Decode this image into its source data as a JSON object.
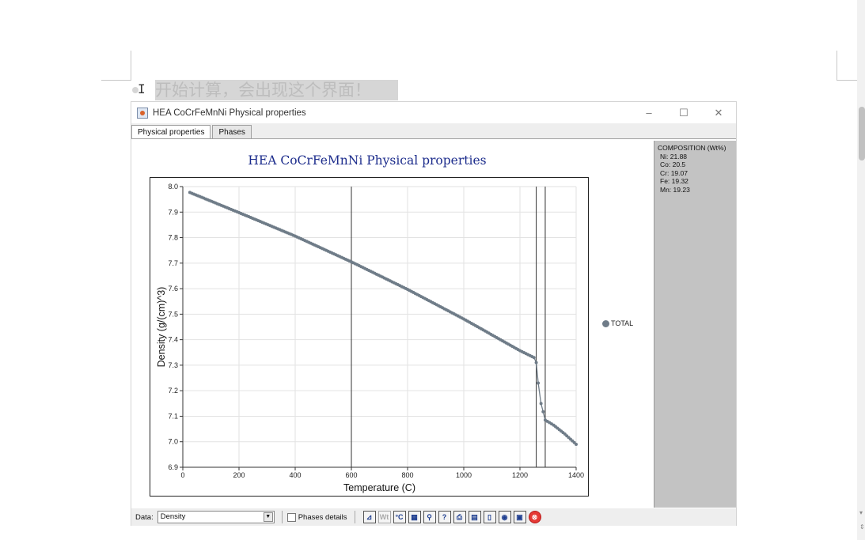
{
  "document": {
    "instruction_text": "开始计算，会出现这个界面！"
  },
  "window": {
    "title": "HEA CoCrFeMnNi Physical properties",
    "controls": {
      "minimize": "–",
      "maximize": "☐",
      "close": "✕"
    }
  },
  "tabs": [
    {
      "label": "Physical properties",
      "active": true
    },
    {
      "label": "Phases",
      "active": false
    }
  ],
  "composition": {
    "header": "COMPOSITION (Wt%)",
    "items": [
      "Ni: 21.88",
      "Co: 20.5",
      "Cr: 19.07",
      "Fe: 19.32",
      "Mn: 19.23"
    ]
  },
  "bottom_bar": {
    "data_label": "Data:",
    "data_value": "Density",
    "phases_details_label": "Phases details",
    "tools": [
      {
        "icon": "plot-icon",
        "glyph": "⊿"
      },
      {
        "icon": "wt-icon",
        "glyph": "Wt",
        "disabled": true
      },
      {
        "icon": "celsius-icon",
        "glyph": "°C"
      },
      {
        "icon": "table-icon",
        "glyph": "▦"
      },
      {
        "icon": "zoom-icon",
        "glyph": "⚲"
      },
      {
        "icon": "help-icon",
        "glyph": "?"
      },
      {
        "icon": "print-icon",
        "glyph": "⎙"
      },
      {
        "icon": "clipboard-icon",
        "glyph": "▤"
      },
      {
        "icon": "page-icon",
        "glyph": "▯"
      },
      {
        "icon": "camera-icon",
        "glyph": "◉"
      },
      {
        "icon": "save-icon",
        "glyph": "▣"
      },
      {
        "icon": "close-icon",
        "glyph": "⊗",
        "red": true
      }
    ]
  },
  "chart_data": {
    "type": "line",
    "title": "HEA CoCrFeMnNi Physical properties",
    "xlabel": "Temperature (C)",
    "ylabel": "Density (g/(cm)^3)",
    "xlim": [
      0,
      1400
    ],
    "ylim": [
      6.9,
      8.0
    ],
    "xticks": [
      0,
      200,
      400,
      600,
      800,
      1000,
      1200,
      1400
    ],
    "yticks": [
      6.9,
      7.0,
      7.1,
      7.2,
      7.3,
      7.4,
      7.5,
      7.6,
      7.7,
      7.8,
      7.9,
      8.0
    ],
    "grid": true,
    "legend_position": "right",
    "vertical_lines_x": [
      600,
      1258,
      1290
    ],
    "series": [
      {
        "name": "TOTAL",
        "color": "#6f7c88",
        "points": [
          [
            25,
            7.977
          ],
          [
            200,
            7.898
          ],
          [
            400,
            7.806
          ],
          [
            600,
            7.705
          ],
          [
            800,
            7.597
          ],
          [
            1000,
            7.481
          ],
          [
            1200,
            7.357
          ],
          [
            1250,
            7.33
          ],
          [
            1258,
            7.31
          ],
          [
            1265,
            7.23
          ],
          [
            1275,
            7.15
          ],
          [
            1290,
            7.085
          ],
          [
            1320,
            7.065
          ],
          [
            1360,
            7.03
          ],
          [
            1400,
            6.99
          ]
        ]
      }
    ]
  }
}
